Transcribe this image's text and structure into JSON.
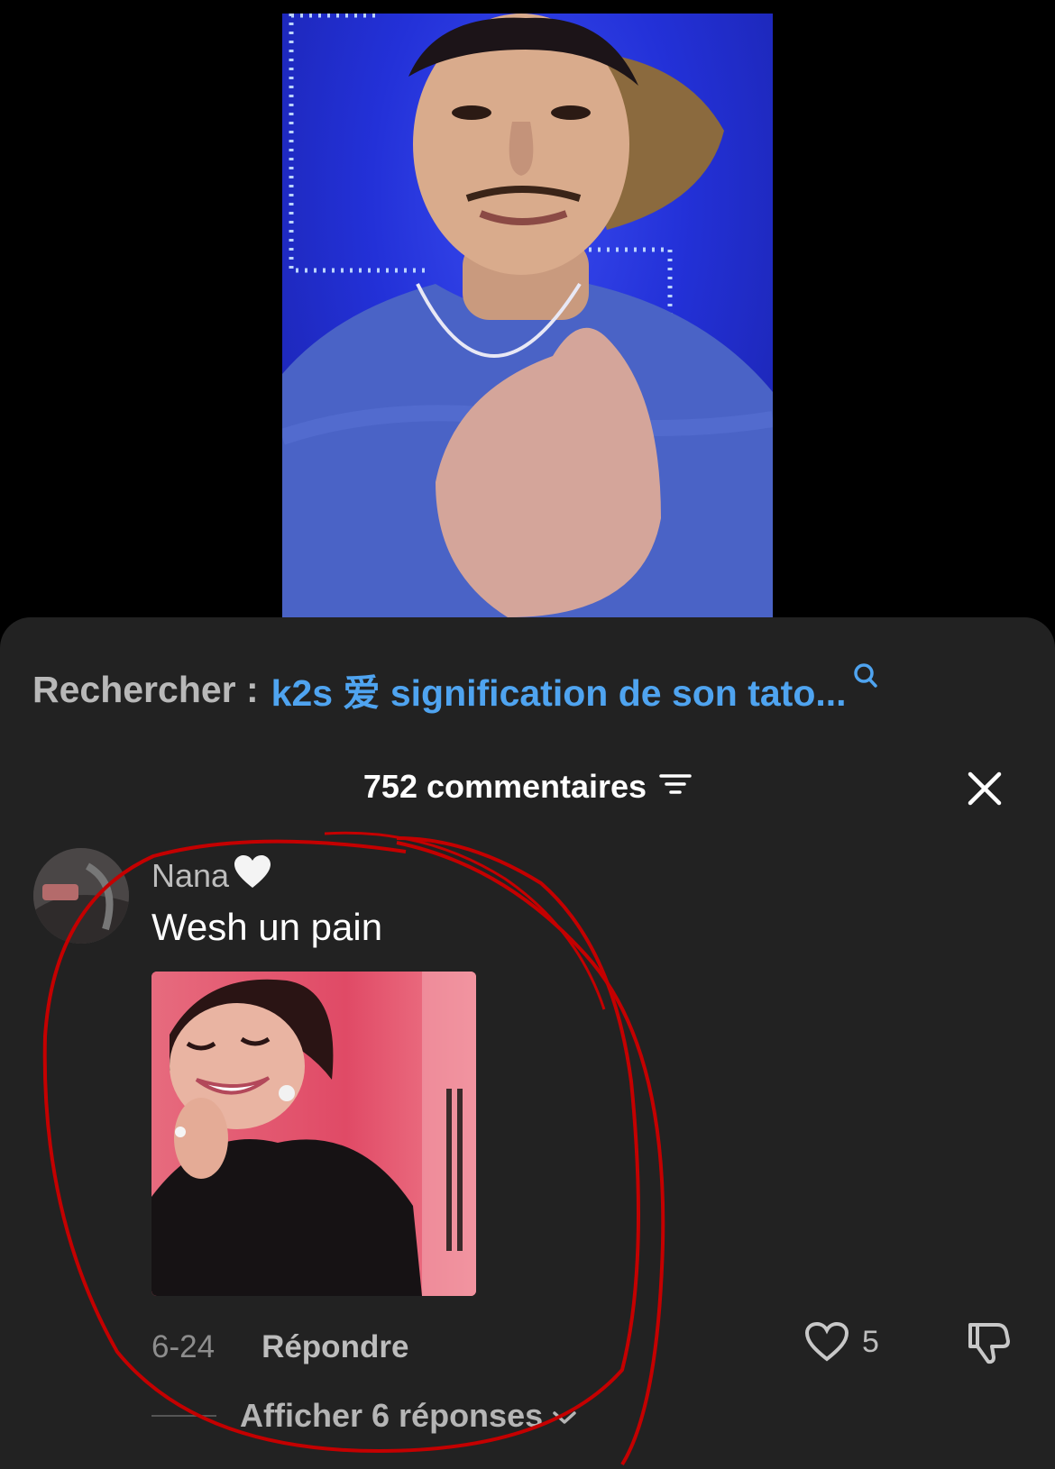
{
  "search": {
    "prefix": "Rechercher :",
    "query": "k2s 爱 signification de son tato..."
  },
  "comments": {
    "count_label": "752 commentaires"
  },
  "comment": {
    "username": "Nana",
    "text": "Wesh un pain",
    "date": "6-24",
    "reply_label": "Répondre",
    "like_count": "5",
    "view_replies_label": "Afficher 6 réponses"
  },
  "colors": {
    "sheet_bg": "#222222",
    "search_accent": "#4fa4f0",
    "annotation": "#cc0000"
  },
  "icons": [
    "search-icon",
    "filter-icon",
    "close-icon",
    "heart-icon",
    "dislike-icon",
    "chevron-down-icon",
    "white-heart-emoji"
  ]
}
